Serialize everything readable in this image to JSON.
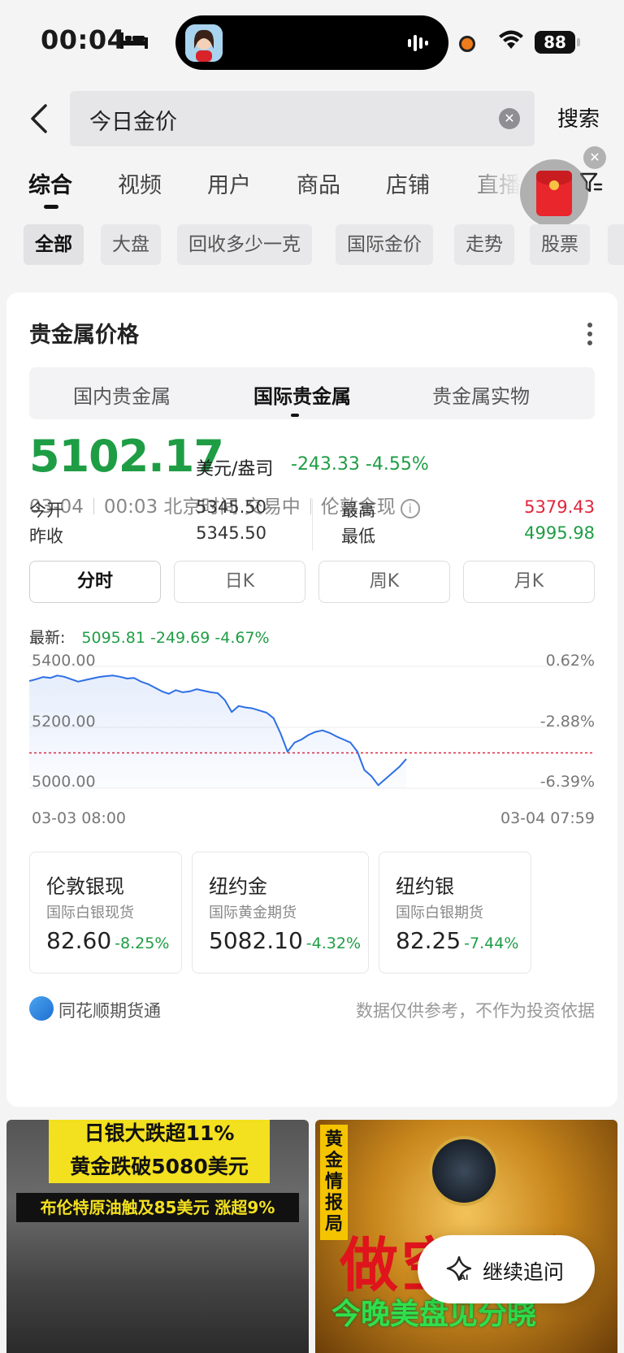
{
  "status_bar": {
    "time": "00:04",
    "battery": "88"
  },
  "search": {
    "query": "今日金价",
    "button": "搜索"
  },
  "tabs": [
    "综合",
    "视频",
    "用户",
    "商品",
    "店铺",
    "直播"
  ],
  "chips": [
    "全部",
    "大盘",
    "回收多少一克",
    "国际金价",
    "走势",
    "股票"
  ],
  "card": {
    "title": "贵金属价格",
    "segments": [
      "国内贵金属",
      "国际贵金属",
      "贵金属实物"
    ],
    "price": "5102.17",
    "unit": "美元/盎司",
    "change": "-243.33 -4.55%",
    "date": "03-04",
    "time_info": "00:03 北京时间 交易中",
    "market": "伦敦金现",
    "stats": {
      "open_label": "今开",
      "open": "5345.50",
      "prev_label": "昨收",
      "prev": "5345.50",
      "high_label": "最高",
      "high": "5379.43",
      "low_label": "最低",
      "low": "4995.98"
    },
    "kline_tabs": [
      "分时",
      "日K",
      "周K",
      "月K"
    ],
    "latest_label": "最新:",
    "latest_value": "5095.81 -249.69 -4.67%",
    "related": [
      {
        "name": "伦敦银现",
        "sub": "国际白银现货",
        "value": "82.60",
        "change": "-8.25%"
      },
      {
        "name": "纽约金",
        "sub": "国际黄金期货",
        "value": "5082.10",
        "change": "-4.32%"
      },
      {
        "name": "纽约银",
        "sub": "国际白银期货",
        "value": "82.25",
        "change": "-7.44%"
      }
    ],
    "source": "同花顺期货通",
    "disclaimer": "数据仅供参考，不作为投资依据"
  },
  "chart_data": {
    "type": "line",
    "y_ticks_left": [
      "5400.00",
      "5200.00",
      "5000.00"
    ],
    "y_ticks_right": [
      "0.62%",
      "-2.88%",
      "-6.39%"
    ],
    "x_labels": [
      "03-03 08:00",
      "03-04 07:59"
    ],
    "ylim": [
      5000,
      5400
    ],
    "reference_value": 5345.5,
    "series": [
      {
        "values": [
          5352,
          5358,
          5365,
          5362,
          5370,
          5366,
          5358,
          5350,
          5355,
          5360,
          5365,
          5368,
          5370,
          5366,
          5360,
          5362,
          5350,
          5342,
          5330,
          5318,
          5310,
          5322,
          5315,
          5318,
          5325,
          5320,
          5315,
          5312,
          5290,
          5250,
          5270,
          5265,
          5262,
          5255,
          5248,
          5230,
          5180,
          5120,
          5150,
          5160,
          5175,
          5185,
          5190,
          5182,
          5170,
          5160,
          5150,
          5120,
          5060,
          5040,
          5010,
          5030,
          5050,
          5070,
          5095.81
        ]
      }
    ],
    "colors": {
      "line": "#2e6fe6",
      "reference": "#e0253a",
      "up": "#e0253a",
      "down": "#1f9d45"
    }
  },
  "thumbnails": [
    {
      "lines": [
        "日银大跌超11%",
        "黄金跌破5080美元",
        "布伦特原油触及85美元 涨超9%"
      ]
    },
    {
      "vertical": "黄金情报局",
      "big": "做空黄金",
      "green": "今晚美盘见分晓"
    }
  ],
  "followup_button": "继续追问"
}
